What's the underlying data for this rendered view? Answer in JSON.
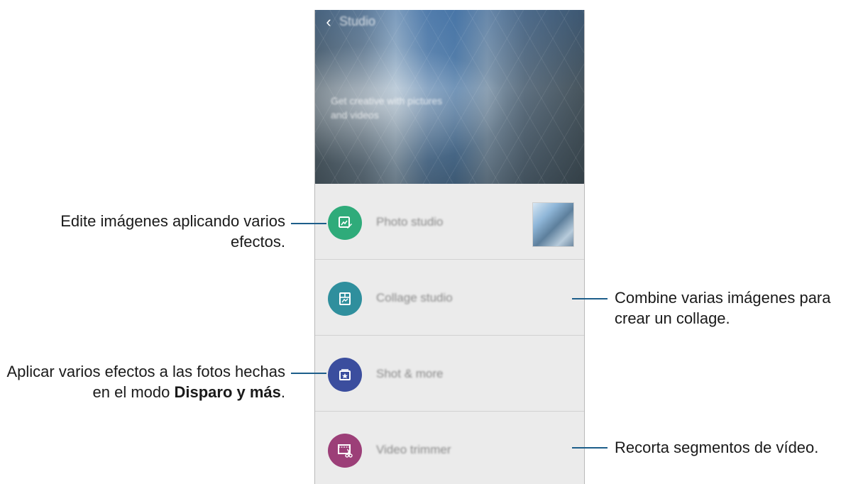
{
  "app": {
    "back_icon": "chevron-left-icon",
    "title": "Studio",
    "tagline": "Get creative with pictures and videos"
  },
  "features": [
    {
      "label": "Photo studio",
      "icon": "photo-edit-icon",
      "color": "#2fab7a"
    },
    {
      "label": "Collage studio",
      "icon": "collage-icon",
      "color": "#2f8f9d"
    },
    {
      "label": "Shot & more",
      "icon": "shot-more-icon",
      "color": "#3b4e9e"
    },
    {
      "label": "Video trimmer",
      "icon": "video-trim-icon",
      "color": "#9c3f78"
    }
  ],
  "callouts": {
    "photo": "Edite imágenes aplicando varios efectos.",
    "collage": "Combine varias imágenes para crear un collage.",
    "shot_prefix": "Aplicar varios efectos a las fotos hechas en el modo ",
    "shot_bold": "Disparo y más",
    "shot_suffix": ".",
    "video": "Recorta segmentos de vídeo."
  },
  "colors": {
    "leader": "#1d5e8a"
  }
}
